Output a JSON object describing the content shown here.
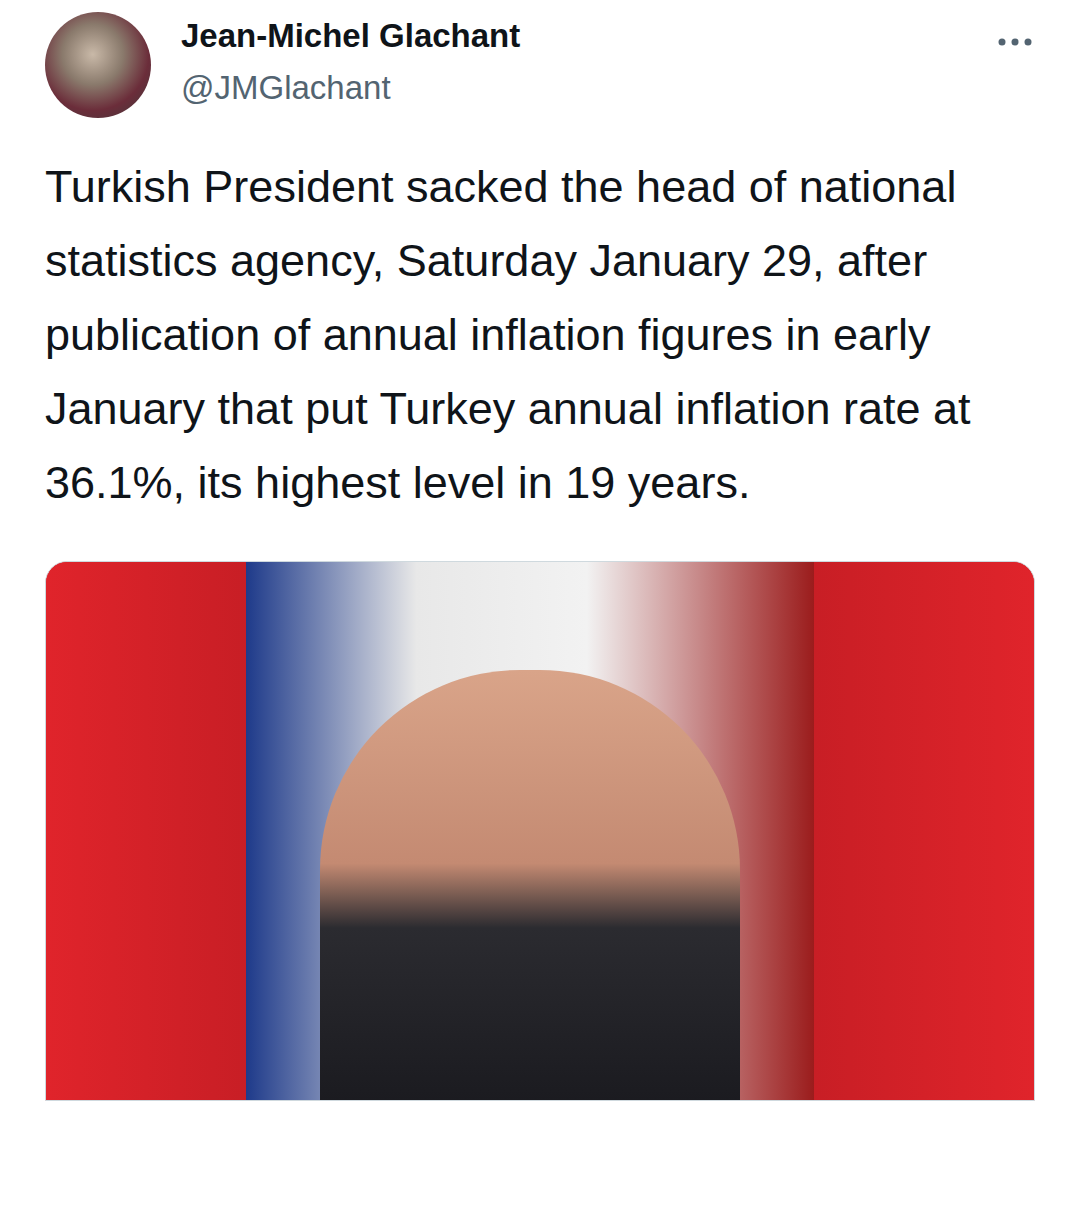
{
  "author": {
    "name": "Jean-Michel Glachant",
    "handle": "@JMGlachant"
  },
  "tweet": {
    "text": "Turkish President sacked the head of national statistics agency, Saturday January 29, after publication of annual inflation figures in early January that put Turkey annual inflation rate at 36.1%, its highest level in 19 years."
  }
}
